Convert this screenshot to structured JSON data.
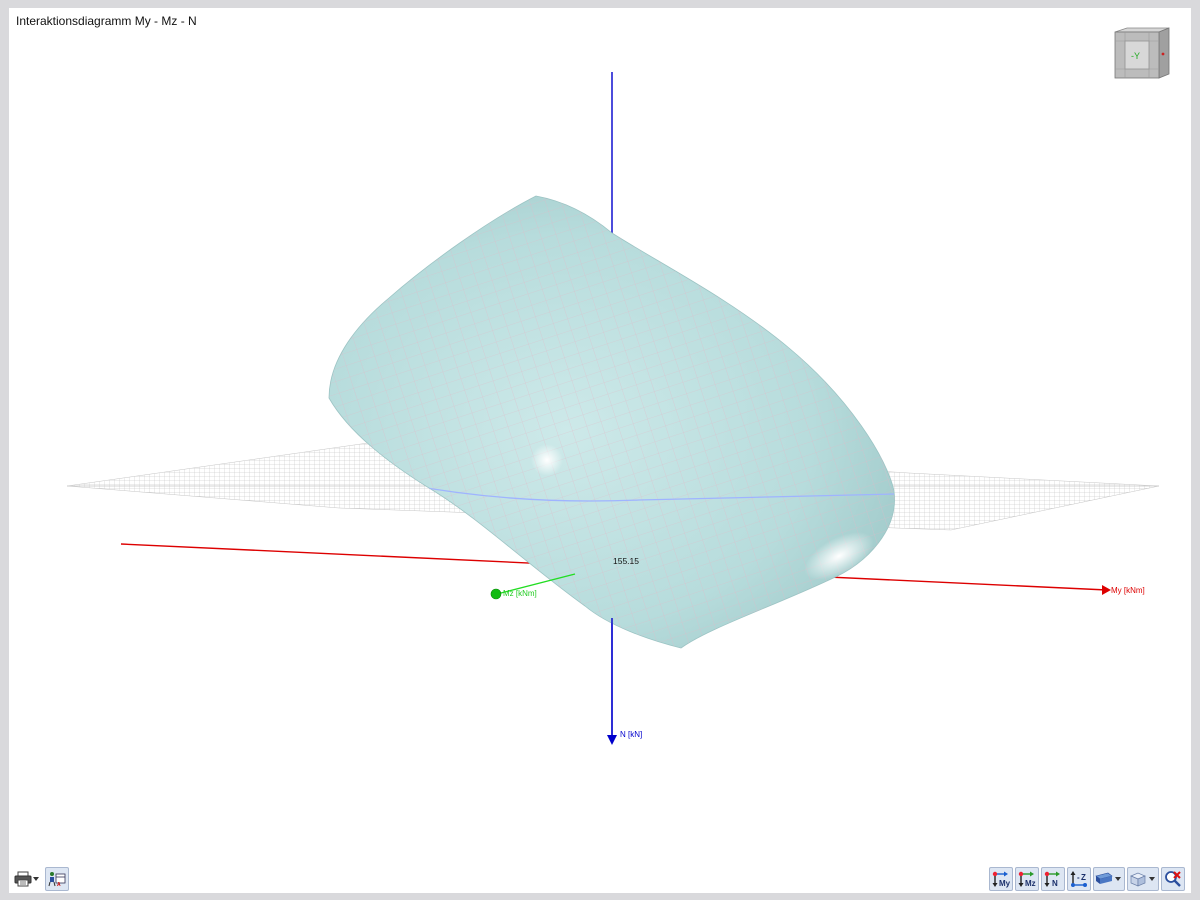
{
  "window": {
    "title": "Interaktionsdiagramm My - Mz - N"
  },
  "axes": {
    "my_label": "My [kNm]",
    "mz_label": "Mz [kNm]",
    "n_label": "N [kN]",
    "colors": {
      "my": "#dd0000",
      "mz": "#22dd22",
      "n": "#0000cc"
    }
  },
  "surface": {
    "value_label": "155.15",
    "fill_color": "#bfe0e0",
    "mesh_color": "#e2b8c6"
  },
  "navcube": {
    "face_label": "-Y"
  },
  "toolbar_left": {
    "items": [
      {
        "icon": "printer-icon",
        "has_dropdown": true
      },
      {
        "icon": "view-settings-icon",
        "has_dropdown": false
      }
    ]
  },
  "toolbar_right": {
    "items": [
      {
        "icon": "axis-my-icon",
        "label": "My"
      },
      {
        "icon": "axis-mz-icon",
        "label": "Mz"
      },
      {
        "icon": "axis-n-icon",
        "label": "N"
      },
      {
        "icon": "axis-z-icon",
        "label": "Z"
      },
      {
        "icon": "display-mode-icon",
        "has_dropdown": true
      },
      {
        "icon": "view-cube-icon",
        "has_dropdown": true
      },
      {
        "icon": "reset-view-icon"
      }
    ]
  }
}
